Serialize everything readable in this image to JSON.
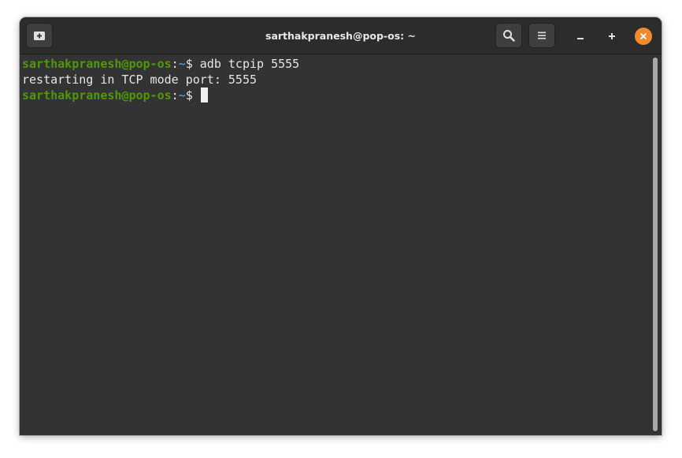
{
  "window": {
    "title": "sarthakpranesh@pop-os: ~"
  },
  "icons": {
    "new_tab": "new-tab-icon",
    "search": "search-icon",
    "menu": "hamburger-menu-icon",
    "minimize": "minimize-icon",
    "maximize": "maximize-icon",
    "close": "close-icon"
  },
  "colors": {
    "prompt_user": "#4e9a06",
    "prompt_path": "#5a8fd6",
    "close_button": "#f28b30",
    "terminal_bg": "#333333"
  },
  "terminal": {
    "lines": [
      {
        "user_host": "sarthakpranesh@pop-os",
        "colon": ":",
        "path": "~",
        "dollar": "$ ",
        "command": "adb tcpip 5555"
      },
      {
        "output": "restarting in TCP mode port: 5555"
      },
      {
        "user_host": "sarthakpranesh@pop-os",
        "colon": ":",
        "path": "~",
        "dollar": "$ ",
        "command": ""
      }
    ]
  }
}
